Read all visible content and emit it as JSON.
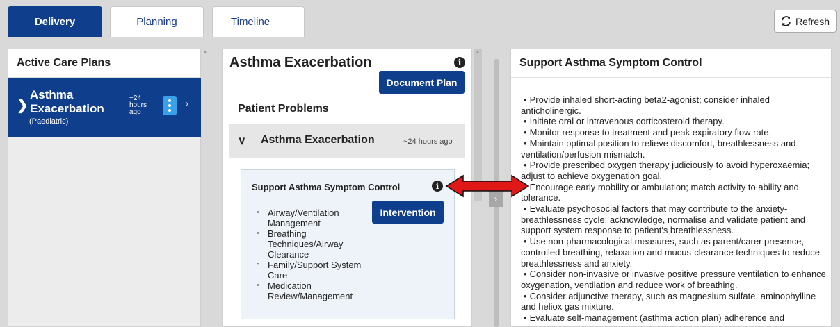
{
  "tabs": [
    {
      "label": "Delivery",
      "active": true
    },
    {
      "label": "Planning",
      "active": false
    },
    {
      "label": "Timeline",
      "active": false
    }
  ],
  "toolbar": {
    "refresh_label": "Refresh"
  },
  "left_panel": {
    "title": "Active Care Plans",
    "plan": {
      "title_line1": "Asthma",
      "title_line2": "Exacerbation",
      "subtitle": "(Paediatric)",
      "time_line1": "~24",
      "time_line2": "hours",
      "time_line3": "ago"
    }
  },
  "middle_panel": {
    "title": "Asthma Exacerbation",
    "document_button": "Document Plan",
    "section_title": "Patient Problems",
    "problem": {
      "name": "Asthma Exacerbation",
      "time": "~24 hours ago"
    },
    "goal": {
      "title": "Support Asthma Symptom Control",
      "intervention_button": "Intervention",
      "items": [
        "Airway/Ventilation Management",
        "Breathing Techniques/Airway Clearance",
        "Family/Support System Care",
        "Medication Review/Management"
      ]
    }
  },
  "right_panel": {
    "title": "Support Asthma Symptom Control",
    "guidance": [
      "Provide inhaled short-acting beta2-agonist; consider inhaled anticholinergic.",
      "Initiate oral or intravenous corticosteroid therapy.",
      "Monitor response to treatment and peak expiratory flow rate.",
      "Maintain optimal position to relieve discomfort, breathlessness and ventilation/perfusion mismatch.",
      "Provide prescribed oxygen therapy judiciously to avoid hyperoxaemia; adjust to achieve oxygenation goal.",
      "Encourage early mobility or ambulation; match activity to ability and tolerance.",
      "Evaluate psychosocial factors that may contribute to the anxiety-breathlessness cycle; acknowledge, normalise and validate patient and support system response to patient's breathlessness.",
      "Use non-pharmacological measures, such as parent/carer presence, controlled breathing, relaxation and mucus-clearance techniques to reduce breathlessness and anxiety.",
      "Consider non-invasive or invasive positive pressure ventilation to enhance oxygenation, ventilation and reduce work of breathing.",
      "Consider adjunctive therapy, such as magnesium sulfate, aminophylline and heliox gas mixture.",
      "Evaluate self-management (asthma action plan) adherence and"
    ]
  },
  "colors": {
    "accent": "#0e3e8c",
    "kebab": "#3aa0e8",
    "arrow": "#e01818"
  }
}
